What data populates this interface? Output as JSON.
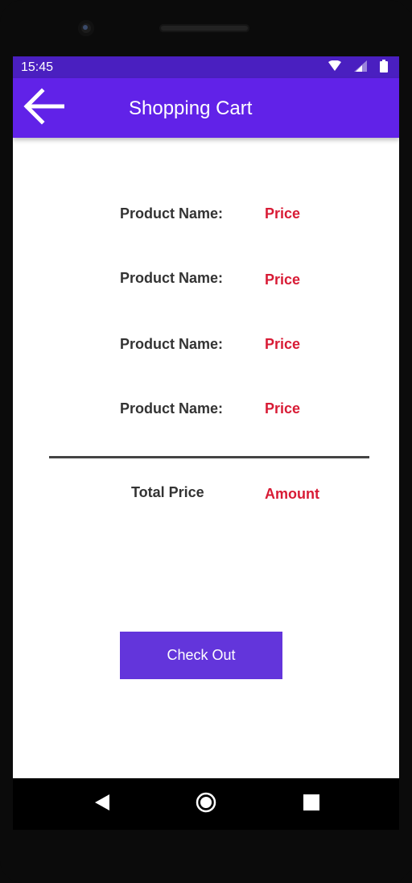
{
  "status_bar": {
    "time": "15:45",
    "icons": [
      "wifi-icon",
      "signal-icon",
      "battery-icon"
    ]
  },
  "app_bar": {
    "back_icon": "arrow-left-icon",
    "title": "Shopping Cart"
  },
  "cart": {
    "items": [
      {
        "name_label": "Product Name:",
        "price_label": "Price"
      },
      {
        "name_label": "Product Name:",
        "price_label": "Price"
      },
      {
        "name_label": "Product Name:",
        "price_label": "Price"
      },
      {
        "name_label": "Product Name:",
        "price_label": "Price"
      }
    ],
    "total_label": "Total Price",
    "total_amount": "Amount",
    "checkout_label": "Check Out"
  },
  "nav_bar": {
    "icons": [
      "back-triangle-icon",
      "home-circle-icon",
      "recents-square-icon"
    ]
  },
  "colors": {
    "status_bar": "#4a1fc0",
    "app_bar": "#6122e8",
    "button": "#6335db",
    "price_text": "#d81b35",
    "label_text": "#333333"
  }
}
